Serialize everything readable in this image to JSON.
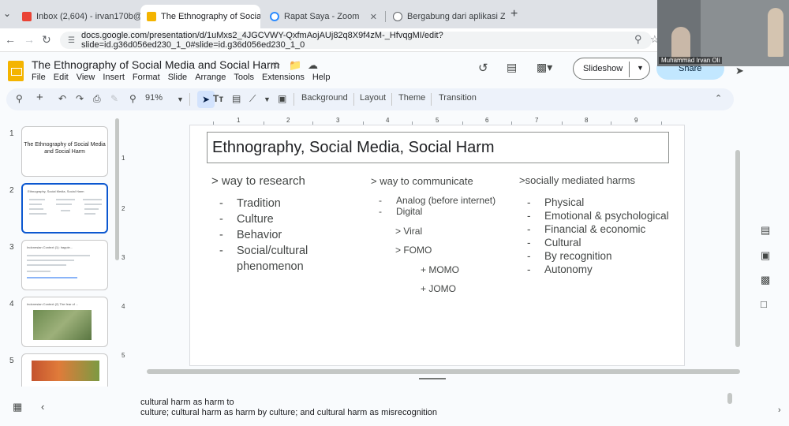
{
  "browser": {
    "tabs": [
      {
        "label": "Inbox (2,604) - irvan170b@gm…",
        "favicon_color": "#ea4335",
        "active": false
      },
      {
        "label": "The Ethnography of Social Med…",
        "favicon_color": "#f4b400",
        "active": true
      },
      {
        "label": "Rapat Saya - Zoom",
        "favicon_color": "#2d8cff",
        "active": false
      },
      {
        "label": "Bergabung dari aplikasi Zoom …",
        "favicon_color": "#5f6368",
        "active": false
      }
    ],
    "url": "docs.google.com/presentation/d/1uMxs2_4JGCVWY-QxfmAojAUj82q8X9f4zM-_HfvqgMI/edit?slide=id.g36d056ed230_1_0#slide=id.g36d056ed230_1_0"
  },
  "zoom_overlay": {
    "participant_name": "Muhammad Irvan Oli"
  },
  "doc": {
    "title": "The Ethnography of  Social Media and Social Harm",
    "menu": [
      "File",
      "Edit",
      "View",
      "Insert",
      "Format",
      "Slide",
      "Arrange",
      "Tools",
      "Extensions",
      "Help"
    ],
    "slideshow_label": "Slideshow",
    "share_label": "Share"
  },
  "toolbar": {
    "zoom": "91%",
    "background_label": "Background",
    "layout_label": "Layout",
    "theme_label": "Theme",
    "transition_label": "Transition"
  },
  "filmstrip": {
    "slides": [
      {
        "num": "1",
        "title": "The Ethnography of Social Media and Social Harm"
      },
      {
        "num": "2",
        "title": "Ethnography, Social Media, Social Harm"
      },
      {
        "num": "3",
        "title": "Indonesian Context (1): happie..."
      },
      {
        "num": "4",
        "title": "Indonesian Context (2) The fear of ..."
      },
      {
        "num": "5",
        "title": ""
      }
    ]
  },
  "ruler": {
    "top": [
      "1",
      "2",
      "3",
      "4",
      "5",
      "6",
      "7",
      "8",
      "9"
    ],
    "left": [
      "1",
      "2",
      "3",
      "4",
      "5"
    ]
  },
  "slide": {
    "title": "Ethnography, Social Media, Social Harm",
    "col1": {
      "heading": "> way to research",
      "items": [
        {
          "dash": "-",
          "text": "Tradition"
        },
        {
          "dash": "-",
          "text": "Culture"
        },
        {
          "dash": "-",
          "text": "Behavior"
        },
        {
          "dash": "-",
          "text": "Social/cultural"
        },
        {
          "dash": "",
          "text": "phenomenon"
        }
      ]
    },
    "col2": {
      "heading": "> way to communicate",
      "items": [
        {
          "dash": "-",
          "text": "Analog (before internet)"
        },
        {
          "dash": "-",
          "text": "Digital"
        }
      ],
      "viral": "> Viral",
      "fomo": "> FOMO",
      "momo": "+ MOMO",
      "jomo": "+ JOMO"
    },
    "col3": {
      "heading": ">socially mediated harms",
      "items": [
        {
          "dash": "-",
          "text": "Physical"
        },
        {
          "dash": "-",
          "text": "Emotional & psychological"
        },
        {
          "dash": "-",
          "text": "Financial & economic"
        },
        {
          "dash": "-",
          "text": "Cultural"
        },
        {
          "dash": "-",
          "text": "By recognition"
        },
        {
          "dash": "-",
          "text": "Autonomy"
        }
      ]
    }
  },
  "notes": {
    "line1": "cultural harm as harm to",
    "line2": "culture; cultural harm as harm by culture; and cultural harm as misrecognition"
  }
}
